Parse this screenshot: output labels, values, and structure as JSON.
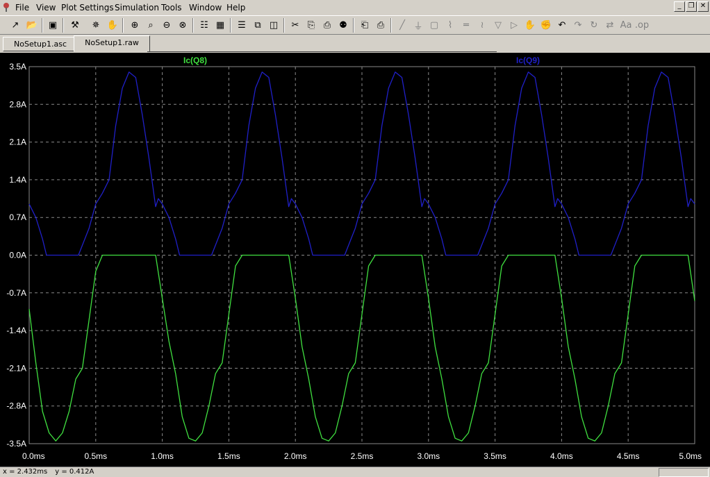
{
  "menu": {
    "items": [
      "File",
      "View",
      "Plot Settings",
      "Simulation",
      "Tools",
      "Window",
      "Help"
    ]
  },
  "window_controls": {
    "minimize": "_",
    "restore": "❐",
    "close": "✕"
  },
  "toolbar": {
    "icons": [
      "new-schematic-icon",
      "open-icon",
      "save-icon",
      "control-panel-icon",
      "run-icon",
      "halt-icon",
      "zoom-in-icon",
      "zoom-area-icon",
      "zoom-out-icon",
      "zoom-cancel-icon",
      "autorange-icon",
      "waveform-icon",
      "tile-horizontal-icon",
      "cascade-icon",
      "tile-vertical-icon",
      "cut-icon",
      "copy-icon",
      "paste-icon",
      "find-icon",
      "print-preview-icon",
      "print-icon",
      "draw-wire-icon",
      "ground-icon",
      "label-net-icon",
      "resistor-icon",
      "capacitor-icon",
      "inductor-icon",
      "diode-icon",
      "component-icon",
      "move-icon",
      "drag-icon",
      "undo-icon",
      "redo-icon",
      "rotate-icon",
      "mirror-icon",
      "text-icon",
      "spice-directive-icon"
    ]
  },
  "tabs": [
    {
      "label": "NoSetup1.asc",
      "active": false
    },
    {
      "label": "NoSetup1.raw",
      "active": true
    }
  ],
  "colors": {
    "background": "#000000",
    "grid": "#8a8a8a",
    "axis_text": "#ffffff",
    "trace_q8": "#40e040",
    "trace_q9": "#2020c8"
  },
  "status": {
    "x_readout": "x = 2.432ms",
    "y_readout": "y = 0.412A"
  },
  "chart_data": {
    "type": "line",
    "title": "",
    "xlabel": "",
    "ylabel": "",
    "xlim": [
      0,
      5.0
    ],
    "ylim": [
      -3.5,
      3.5
    ],
    "x_unit": "ms",
    "y_unit": "A",
    "x_ticks": [
      "0.0ms",
      "0.5ms",
      "1.0ms",
      "1.5ms",
      "2.0ms",
      "2.5ms",
      "3.0ms",
      "3.5ms",
      "4.0ms",
      "4.5ms",
      "5.0ms"
    ],
    "y_ticks": [
      "3.5A",
      "2.8A",
      "2.1A",
      "1.4A",
      "0.7A",
      "0.0A",
      "-0.7A",
      "-1.4A",
      "-2.1A",
      "-2.8A",
      "-3.5A"
    ],
    "grid": true,
    "legend": "top",
    "series": [
      {
        "name": "Ic(Q8)",
        "color": "#40e040",
        "x": [
          0.0,
          0.05,
          0.1,
          0.15,
          0.2,
          0.25,
          0.3,
          0.35,
          0.4,
          0.45,
          0.5,
          0.55,
          0.6,
          0.95,
          1.0,
          1.05,
          1.1,
          1.15,
          1.2,
          1.25,
          1.3,
          1.35,
          1.4,
          1.45,
          1.5,
          1.55,
          1.6,
          1.95,
          2.0,
          2.05,
          2.1,
          2.15,
          2.2,
          2.25,
          2.3,
          2.35,
          2.4,
          2.45,
          2.5,
          2.55,
          2.6,
          2.95,
          3.0,
          3.05,
          3.1,
          3.15,
          3.2,
          3.25,
          3.3,
          3.35,
          3.4,
          3.45,
          3.5,
          3.55,
          3.6,
          3.95,
          4.0,
          4.05,
          4.1,
          4.15,
          4.2,
          4.25,
          4.3,
          4.35,
          4.4,
          4.45,
          4.5,
          4.55,
          4.6,
          4.95,
          5.0
        ],
        "y": [
          -1.0,
          -2.0,
          -2.9,
          -3.3,
          -3.45,
          -3.3,
          -2.9,
          -2.3,
          -2.1,
          -1.2,
          -0.3,
          0.0,
          0.0,
          0.0,
          -0.8,
          -1.6,
          -2.2,
          -3.0,
          -3.4,
          -3.45,
          -3.3,
          -2.8,
          -2.2,
          -2.0,
          -1.1,
          -0.2,
          0.0,
          0.0,
          -0.8,
          -1.7,
          -2.3,
          -3.0,
          -3.4,
          -3.45,
          -3.3,
          -2.8,
          -2.2,
          -2.0,
          -1.1,
          -0.2,
          0.0,
          0.0,
          -0.8,
          -1.7,
          -2.3,
          -3.0,
          -3.4,
          -3.45,
          -3.3,
          -2.8,
          -2.2,
          -2.0,
          -1.1,
          -0.2,
          0.0,
          0.0,
          -0.8,
          -1.7,
          -2.3,
          -3.0,
          -3.4,
          -3.45,
          -3.3,
          -2.8,
          -2.2,
          -2.0,
          -1.1,
          -0.2,
          0.0,
          0.0,
          -0.85
        ]
      },
      {
        "name": "Ic(Q9)",
        "color": "#2020c8",
        "x": [
          0.0,
          0.05,
          0.1,
          0.13,
          0.37,
          0.45,
          0.5,
          0.55,
          0.6,
          0.65,
          0.7,
          0.75,
          0.8,
          0.85,
          0.9,
          0.95,
          0.97,
          1.0,
          1.05,
          1.1,
          1.13,
          1.37,
          1.45,
          1.5,
          1.55,
          1.6,
          1.65,
          1.7,
          1.75,
          1.8,
          1.85,
          1.9,
          1.95,
          1.97,
          2.0,
          2.05,
          2.1,
          2.13,
          2.37,
          2.45,
          2.5,
          2.55,
          2.6,
          2.65,
          2.7,
          2.75,
          2.8,
          2.85,
          2.9,
          2.95,
          2.97,
          3.0,
          3.05,
          3.1,
          3.13,
          3.37,
          3.45,
          3.5,
          3.55,
          3.6,
          3.65,
          3.7,
          3.75,
          3.8,
          3.85,
          3.9,
          3.95,
          3.97,
          4.0,
          4.05,
          4.1,
          4.13,
          4.37,
          4.45,
          4.5,
          4.55,
          4.6,
          4.65,
          4.7,
          4.75,
          4.8,
          4.85,
          4.9,
          4.95,
          4.97,
          5.0
        ],
        "y": [
          0.95,
          0.7,
          0.3,
          0.0,
          0.0,
          0.5,
          0.95,
          1.15,
          1.4,
          2.4,
          3.1,
          3.4,
          3.3,
          2.6,
          1.8,
          0.9,
          1.05,
          0.95,
          0.7,
          0.3,
          0.0,
          0.0,
          0.5,
          0.95,
          1.15,
          1.4,
          2.4,
          3.1,
          3.4,
          3.3,
          2.6,
          1.8,
          0.9,
          1.05,
          0.95,
          0.7,
          0.3,
          0.0,
          0.0,
          0.5,
          0.95,
          1.15,
          1.4,
          2.4,
          3.1,
          3.4,
          3.3,
          2.6,
          1.8,
          0.9,
          1.05,
          0.95,
          0.7,
          0.3,
          0.0,
          0.0,
          0.5,
          0.95,
          1.15,
          1.4,
          2.4,
          3.1,
          3.4,
          3.3,
          2.6,
          1.8,
          0.9,
          1.05,
          0.95,
          0.7,
          0.3,
          0.0,
          0.0,
          0.5,
          0.95,
          1.15,
          1.4,
          2.4,
          3.1,
          3.4,
          3.3,
          2.6,
          1.8,
          0.9,
          1.05,
          0.95
        ]
      }
    ]
  }
}
